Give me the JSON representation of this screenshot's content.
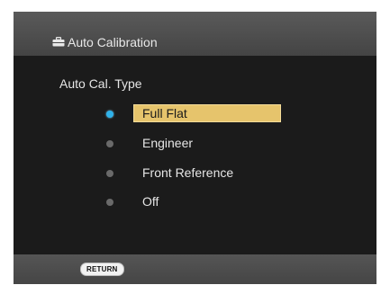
{
  "header": {
    "title": "Auto Calibration",
    "icon": "toolbox-icon"
  },
  "section": {
    "label": "Auto Cal. Type"
  },
  "options": [
    {
      "label": "Full Flat",
      "selected": true
    },
    {
      "label": "Engineer",
      "selected": false
    },
    {
      "label": "Front Reference",
      "selected": false
    },
    {
      "label": "Off",
      "selected": false
    }
  ],
  "footer": {
    "return_label": "RETURN"
  },
  "colors": {
    "highlight": "#e6c46c",
    "selected_dot": "#2fb2ea",
    "unselected_dot": "#6a6a6a",
    "panel_bg": "#1b1b1b",
    "bar_bg": "#4d4d4d"
  }
}
